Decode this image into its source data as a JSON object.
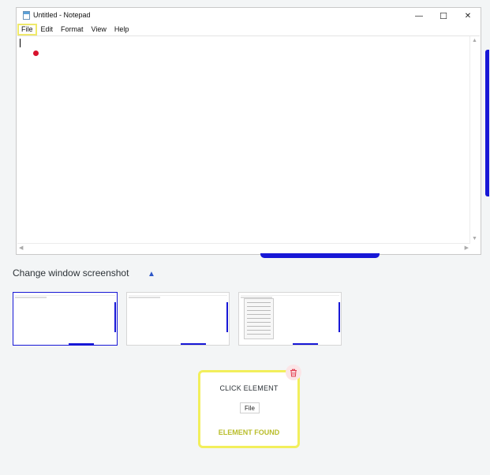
{
  "notepad": {
    "title": "Untitled - Notepad",
    "menu": [
      "File",
      "Edit",
      "Format",
      "View",
      "Help"
    ],
    "window_buttons": {
      "minimize": "—",
      "maximize": "☐",
      "close": "✕"
    }
  },
  "section": {
    "title": "Change window screenshot",
    "toggle_icon": "chevron-up-icon"
  },
  "thumbnails": [
    {
      "state": "selected"
    },
    {
      "state": "normal"
    },
    {
      "state": "normal"
    }
  ],
  "step_card": {
    "title": "CLICK ELEMENT",
    "target": "File",
    "status": "ELEMENT FOUND",
    "delete_icon": "trash-icon"
  },
  "colors": {
    "accent_blue": "#1717d6",
    "highlight_yellow": "#f2ef5c",
    "status_text": "#b9bd2b",
    "click_dot": "#d7122d",
    "delete_bg": "#fbe5e7"
  }
}
